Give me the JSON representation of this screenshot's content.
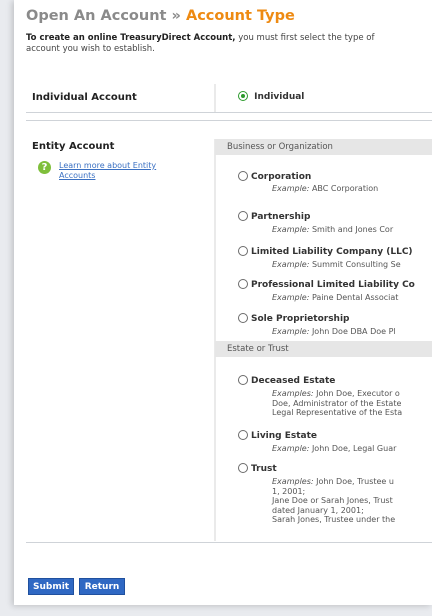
{
  "header": {
    "crumb": "Open An Account",
    "separator": "»",
    "current": "Account Type"
  },
  "intro": {
    "bold": "To create an online TreasuryDirect Account,",
    "line1_rest": " you must first select the type of",
    "line2": "account you wish to establish."
  },
  "individual": {
    "section_label": "Individual Account",
    "option_label": "Individual",
    "selected": true
  },
  "entity": {
    "section_label": "Entity Account",
    "help_link_line1": "Learn more about Entity",
    "help_link_line2": "Accounts",
    "business_header": "Business or Organization",
    "estate_header": "Estate or Trust",
    "business_options": [
      {
        "label": "Corporation",
        "prefix": "Example:",
        "text": " ABC Corporation"
      },
      {
        "label": "Partnership",
        "prefix": "Example:",
        "text": " Smith and Jones Cor"
      },
      {
        "label": "Limited Liability Company (LLC)",
        "prefix": "Example:",
        "text": " Summit Consulting Se"
      },
      {
        "label": "Professional Limited Liability Co",
        "prefix": "Example:",
        "text": " Paine Dental Associat"
      },
      {
        "label": "Sole Proprietorship",
        "prefix": "Example:",
        "text": " John Doe DBA Doe Pl"
      }
    ],
    "deceased": {
      "label": "Deceased Estate",
      "prefix": "Examples:",
      "line1": " John Doe, Executor o",
      "line2": "Doe, Administrator of the Estate",
      "line3": "Legal Representative of the Esta"
    },
    "living": {
      "label": "Living Estate",
      "prefix": "Example:",
      "text": " John Doe, Legal Guar"
    },
    "trust": {
      "label": "Trust",
      "prefix": "Examples:",
      "line1": " John Doe, Trustee u",
      "line2": "1, 2001;",
      "line3": "Jane Doe or Sarah Jones, Trust",
      "line4": "dated January 1, 2001;",
      "line5": "Sarah Jones, Trustee under the"
    }
  },
  "buttons": {
    "submit": "Submit",
    "return": "Return"
  }
}
